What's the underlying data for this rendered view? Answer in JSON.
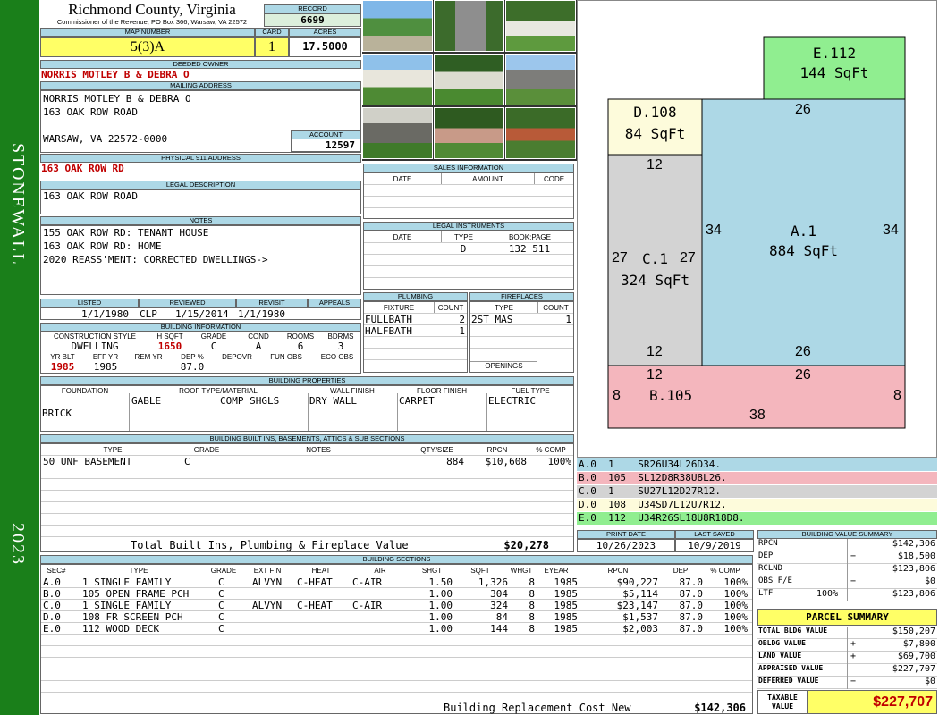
{
  "header": {
    "county": "Richmond County, Virginia",
    "commissioner": "Commissioner of the Revenue, PO Box 366, Warsaw, VA 22572",
    "record_label": "RECORD",
    "record": "6699"
  },
  "map": {
    "map_label": "MAP NUMBER",
    "map_number": "5(3)A",
    "card_label": "CARD",
    "card": "1",
    "acres_label": "ACRES",
    "acres": "17.5000"
  },
  "sidebar": {
    "district": "STONEWALL",
    "year": "2023"
  },
  "owner": {
    "label": "DEEDED OWNER",
    "name": "NORRIS MOTLEY B & DEBRA O",
    "mail_label": "MAILING ADDRESS",
    "mail1": "NORRIS MOTLEY B & DEBRA O",
    "mail2": "163 OAK ROW ROAD",
    "mail3": "WARSAW, VA 22572-0000",
    "account_label": "ACCOUNT",
    "account": "12597"
  },
  "physical": {
    "label": "PHYSICAL 911 ADDRESS",
    "value": "163 OAK ROW RD"
  },
  "legal": {
    "label": "LEGAL DESCRIPTION",
    "value": "163 OAK ROW ROAD"
  },
  "notes": {
    "label": "NOTES",
    "l1": "155 OAK ROW RD: TENANT HOUSE",
    "l2": "163 OAK ROW RD: HOME",
    "l3": "2020 REASS'MENT: CORRECTED DWELLINGS->"
  },
  "dates": {
    "listed_label": "LISTED",
    "listed": "1/1/1980",
    "reviewed_label": "REVIEWED",
    "reviewed_by": "CLP",
    "reviewed": "1/15/2014",
    "revisit_label": "REVISIT",
    "revisit": "1/1/1980",
    "appeals_label": "APPEALS"
  },
  "bldginfo": {
    "label": "BUILDING INFORMATION",
    "cs_label": "CONSTRUCTION STYLE",
    "hsqft_label": "H SQFT",
    "grade_label": "GRADE",
    "cond_label": "COND",
    "rooms_label": "ROOMS",
    "bdrms_label": "BDRMS",
    "style": "DWELLING",
    "hsqft": "1650",
    "grade": "C",
    "cond": "A",
    "rooms": "6",
    "bdrms": "3",
    "yrblt_label": "YR BLT",
    "effyr_label": "EFF YR",
    "remyr_label": "REM YR",
    "dep_label": "DEP %",
    "depovr_label": "DEPOVR",
    "funobs_label": "FUN OBS",
    "ecoobs_label": "ECO OBS",
    "yrblt": "1985",
    "effyr": "1985",
    "dep": "87.0"
  },
  "sales": {
    "label": "SALES INFORMATION",
    "date": "DATE",
    "amount": "AMOUNT",
    "code": "CODE"
  },
  "instruments": {
    "label": "LEGAL INSTRUMENTS",
    "date": "DATE",
    "type": "TYPE",
    "bookpage": "BOOK:PAGE",
    "r_type": "D",
    "r_bookpage": "132 511"
  },
  "plumbing": {
    "label": "PLUMBING",
    "fixture": "FIXTURE",
    "count": "COUNT",
    "r1": "FULLBATH",
    "c1": "2",
    "r2": "HALFBATH",
    "c2": "1"
  },
  "fireplaces": {
    "label": "FIREPLACES",
    "type": "TYPE",
    "count": "COUNT",
    "r1": "2ST MAS",
    "c1": "1",
    "openings": "OPENINGS"
  },
  "props": {
    "label": "BUILDING PROPERTIES",
    "foundation_label": "FOUNDATION",
    "roof_label": "ROOF TYPE/MATERIAL",
    "wall_label": "WALL FINISH",
    "floor_label": "FLOOR FINISH",
    "fuel_label": "FUEL TYPE",
    "foundation": "BRICK",
    "roof1": "GABLE",
    "roof2": "COMP SHGLS",
    "wall": "DRY WALL",
    "floor": "CARPET",
    "fuel": "ELECTRIC"
  },
  "builtins": {
    "label": "BUILDING BUILT INS, BASEMENTS, ATTICS & SUB SECTIONS",
    "type": "TYPE",
    "grade": "GRADE",
    "notes": "NOTES",
    "qty": "QTY/SIZE",
    "rpcn": "RPCN",
    "pct": "% COMP",
    "r_type": "50 UNF BASEMENT",
    "r_grade": "C",
    "r_qty": "884",
    "r_rpcn": "$10,608",
    "r_pct": "100%",
    "total_label": "Total Built Ins, Plumbing & Fireplace Value",
    "total": "$20,278"
  },
  "print": {
    "print_label": "PRINT DATE",
    "saved_label": "LAST SAVED",
    "print": "10/26/2023",
    "saved": "10/9/2019"
  },
  "sketch": {
    "e_label": "E.112",
    "e_area": "144 SqFt",
    "d_label": "D.108",
    "d_area": "84 SqFt",
    "a_label": "A.1",
    "a_area": "884 SqFt",
    "c_label": "C.1",
    "c_area": "324 SqFt",
    "b_label": "B.105",
    "dim_26": "26",
    "dim_12": "12",
    "dim_34": "34",
    "dim_27": "27",
    "dim_8": "8",
    "dim_38": "38",
    "lines": [
      {
        "code": "A.0",
        "n": "1",
        "path": "SR26U34L26D34.",
        "color": "#add8e6"
      },
      {
        "code": "B.0",
        "n": "105",
        "path": "SL12D8R38U8L26.",
        "color": "#f4b6bd"
      },
      {
        "code": "C.0",
        "n": "1",
        "path": "SU27L12D27R12.",
        "color": "#d3d3d3"
      },
      {
        "code": "D.0",
        "n": "108",
        "path": "U34SD7L12U7R12.",
        "color": "#fdfbdb"
      },
      {
        "code": "E.0",
        "n": "112",
        "path": "U34R26SL18U8R18D8.",
        "color": "#90ee90"
      }
    ]
  },
  "summary": {
    "label": "BUILDING VALUE SUMMARY",
    "rpcn_l": "RPCN",
    "rpcn": "$142,306",
    "dep_l": "DEP",
    "dep_sign": "−",
    "dep": "$18,500",
    "rclnd_l": "RCLND",
    "rclnd": "$123,806",
    "obs_l": "OBS F/E",
    "obs_sign": "−",
    "obs": "$0",
    "ltf_l": "LTF",
    "ltf_pct": "100%",
    "ltf": "$123,806"
  },
  "parcel": {
    "label": "PARCEL SUMMARY",
    "tbv_l": "TOTAL BLDG VALUE",
    "tbv": "$150,207",
    "obldg_l": "OBLDG VALUE",
    "plus": "+",
    "obldg": "$7,800",
    "land_l": "LAND VALUE",
    "land": "$69,700",
    "appr_l": "APPRAISED VALUE",
    "appr": "$227,707",
    "def_l": "DEFERRED VALUE",
    "minus": "−",
    "def": "$0",
    "tax_l1": "TAXABLE",
    "tax_l2": "VALUE",
    "tax": "$227,707"
  },
  "sections": {
    "label": "BUILDING SECTIONS",
    "h": [
      "SEC#",
      "TYPE",
      "GRADE",
      "EXT FIN",
      "HEAT",
      "AIR",
      "SHGT",
      "SQFT",
      "WHGT",
      "EYEAR",
      "RPCN",
      "DEP",
      "% COMP"
    ],
    "rows": [
      [
        "A.0",
        "1 SINGLE FAMILY",
        "C",
        "ALVYN",
        "C-HEAT",
        "C-AIR",
        "1.50",
        "1,326",
        "8",
        "1985",
        "$90,227",
        "87.0",
        "100%"
      ],
      [
        "B.0",
        "105 OPEN FRAME PCH",
        "C",
        "",
        "",
        "",
        "1.00",
        "304",
        "8",
        "1985",
        "$5,114",
        "87.0",
        "100%"
      ],
      [
        "C.0",
        "1 SINGLE FAMILY",
        "C",
        "ALVYN",
        "C-HEAT",
        "C-AIR",
        "1.00",
        "324",
        "8",
        "1985",
        "$23,147",
        "87.0",
        "100%"
      ],
      [
        "D.0",
        "108 FR SCREEN PCH",
        "C",
        "",
        "",
        "",
        "1.00",
        "84",
        "8",
        "1985",
        "$1,537",
        "87.0",
        "100%"
      ],
      [
        "E.0",
        "112 WOOD DECK",
        "C",
        "",
        "",
        "",
        "1.00",
        "144",
        "8",
        "1985",
        "$2,003",
        "87.0",
        "100%"
      ]
    ],
    "brcn_label": "Building Replacement Cost New",
    "brcn": "$142,306"
  }
}
